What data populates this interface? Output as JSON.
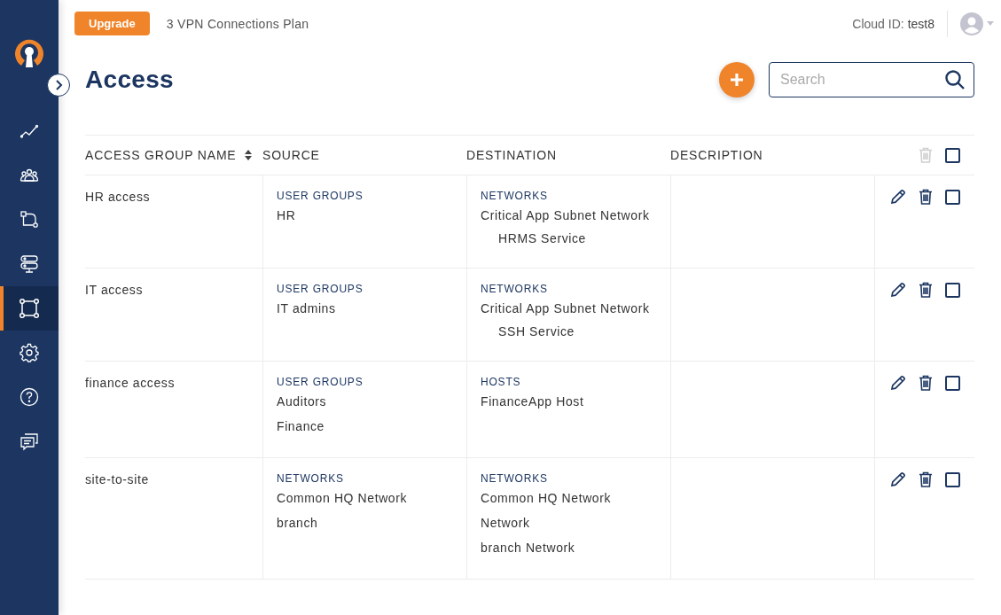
{
  "sidebar": {
    "items": [
      {
        "selected": false
      },
      {
        "selected": false
      },
      {
        "selected": false
      },
      {
        "selected": false
      },
      {
        "selected": true
      },
      {
        "selected": false
      },
      {
        "selected": false
      },
      {
        "selected": false
      }
    ]
  },
  "top_bar": {
    "upgrade_button": "Upgrade",
    "plan": "3 VPN Connections Plan",
    "cloud_id_label": "Cloud ID:",
    "cloud_id": "test8"
  },
  "page": {
    "title": "Access",
    "search": {
      "placeholder": "Search"
    }
  },
  "table": {
    "columns": [
      {
        "label": "ACCESS GROUP NAME",
        "sortable": true
      },
      {
        "label": "SOURCE",
        "sortable": false
      },
      {
        "label": "DESTINATION",
        "sortable": false
      },
      {
        "label": "DESCRIPTION",
        "sortable": false
      }
    ],
    "header_delete_disabled": true,
    "header_checked": false,
    "rows": [
      {
        "name": "HR access",
        "source": {
          "label": "USER GROUPS",
          "items": [
            {
              "text": "HR"
            }
          ]
        },
        "destination": {
          "label": "NETWORKS",
          "items": [
            {
              "text": "Critical App Subnet Network",
              "children": [
                "HRMS Service"
              ]
            }
          ]
        },
        "checked": false
      },
      {
        "name": "IT access",
        "source": {
          "label": "USER GROUPS",
          "items": [
            {
              "text": "IT admins"
            }
          ]
        },
        "destination": {
          "label": "NETWORKS",
          "items": [
            {
              "text": "Critical App Subnet Network",
              "children": [
                "SSH Service"
              ]
            }
          ]
        },
        "checked": false
      },
      {
        "name": "finance access",
        "source": {
          "label": "USER GROUPS",
          "items": [
            {
              "text": "Auditors"
            },
            {
              "text": "Finance"
            }
          ]
        },
        "destination": {
          "label": "HOSTS",
          "items": [
            {
              "text": "FinanceApp Host"
            }
          ]
        },
        "checked": false
      },
      {
        "name": "site-to-site",
        "source": {
          "label": "NETWORKS",
          "items": [
            {
              "text": "Common HQ Network"
            },
            {
              "text": "branch"
            }
          ]
        },
        "destination": {
          "label": "NETWORKS",
          "items": [
            {
              "text": "Common HQ Network"
            },
            {
              "text": "Network"
            },
            {
              "text": "branch Network"
            }
          ]
        },
        "checked": false
      }
    ]
  }
}
